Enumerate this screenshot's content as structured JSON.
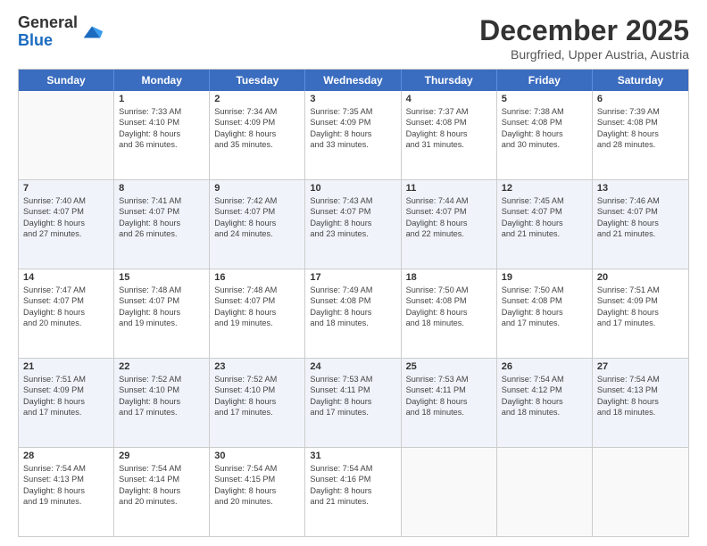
{
  "logo": {
    "general": "General",
    "blue": "Blue"
  },
  "header": {
    "month": "December 2025",
    "location": "Burgfried, Upper Austria, Austria"
  },
  "days": [
    "Sunday",
    "Monday",
    "Tuesday",
    "Wednesday",
    "Thursday",
    "Friday",
    "Saturday"
  ],
  "weeks": [
    {
      "alt": false,
      "cells": [
        {
          "day": "",
          "empty": true
        },
        {
          "day": "1",
          "sunrise": "Sunrise: 7:33 AM",
          "sunset": "Sunset: 4:10 PM",
          "daylight": "Daylight: 8 hours",
          "minutes": "and 36 minutes."
        },
        {
          "day": "2",
          "sunrise": "Sunrise: 7:34 AM",
          "sunset": "Sunset: 4:09 PM",
          "daylight": "Daylight: 8 hours",
          "minutes": "and 35 minutes."
        },
        {
          "day": "3",
          "sunrise": "Sunrise: 7:35 AM",
          "sunset": "Sunset: 4:09 PM",
          "daylight": "Daylight: 8 hours",
          "minutes": "and 33 minutes."
        },
        {
          "day": "4",
          "sunrise": "Sunrise: 7:37 AM",
          "sunset": "Sunset: 4:08 PM",
          "daylight": "Daylight: 8 hours",
          "minutes": "and 31 minutes."
        },
        {
          "day": "5",
          "sunrise": "Sunrise: 7:38 AM",
          "sunset": "Sunset: 4:08 PM",
          "daylight": "Daylight: 8 hours",
          "minutes": "and 30 minutes."
        },
        {
          "day": "6",
          "sunrise": "Sunrise: 7:39 AM",
          "sunset": "Sunset: 4:08 PM",
          "daylight": "Daylight: 8 hours",
          "minutes": "and 28 minutes."
        }
      ]
    },
    {
      "alt": true,
      "cells": [
        {
          "day": "7",
          "sunrise": "Sunrise: 7:40 AM",
          "sunset": "Sunset: 4:07 PM",
          "daylight": "Daylight: 8 hours",
          "minutes": "and 27 minutes."
        },
        {
          "day": "8",
          "sunrise": "Sunrise: 7:41 AM",
          "sunset": "Sunset: 4:07 PM",
          "daylight": "Daylight: 8 hours",
          "minutes": "and 26 minutes."
        },
        {
          "day": "9",
          "sunrise": "Sunrise: 7:42 AM",
          "sunset": "Sunset: 4:07 PM",
          "daylight": "Daylight: 8 hours",
          "minutes": "and 24 minutes."
        },
        {
          "day": "10",
          "sunrise": "Sunrise: 7:43 AM",
          "sunset": "Sunset: 4:07 PM",
          "daylight": "Daylight: 8 hours",
          "minutes": "and 23 minutes."
        },
        {
          "day": "11",
          "sunrise": "Sunrise: 7:44 AM",
          "sunset": "Sunset: 4:07 PM",
          "daylight": "Daylight: 8 hours",
          "minutes": "and 22 minutes."
        },
        {
          "day": "12",
          "sunrise": "Sunrise: 7:45 AM",
          "sunset": "Sunset: 4:07 PM",
          "daylight": "Daylight: 8 hours",
          "minutes": "and 21 minutes."
        },
        {
          "day": "13",
          "sunrise": "Sunrise: 7:46 AM",
          "sunset": "Sunset: 4:07 PM",
          "daylight": "Daylight: 8 hours",
          "minutes": "and 21 minutes."
        }
      ]
    },
    {
      "alt": false,
      "cells": [
        {
          "day": "14",
          "sunrise": "Sunrise: 7:47 AM",
          "sunset": "Sunset: 4:07 PM",
          "daylight": "Daylight: 8 hours",
          "minutes": "and 20 minutes."
        },
        {
          "day": "15",
          "sunrise": "Sunrise: 7:48 AM",
          "sunset": "Sunset: 4:07 PM",
          "daylight": "Daylight: 8 hours",
          "minutes": "and 19 minutes."
        },
        {
          "day": "16",
          "sunrise": "Sunrise: 7:48 AM",
          "sunset": "Sunset: 4:07 PM",
          "daylight": "Daylight: 8 hours",
          "minutes": "and 19 minutes."
        },
        {
          "day": "17",
          "sunrise": "Sunrise: 7:49 AM",
          "sunset": "Sunset: 4:08 PM",
          "daylight": "Daylight: 8 hours",
          "minutes": "and 18 minutes."
        },
        {
          "day": "18",
          "sunrise": "Sunrise: 7:50 AM",
          "sunset": "Sunset: 4:08 PM",
          "daylight": "Daylight: 8 hours",
          "minutes": "and 18 minutes."
        },
        {
          "day": "19",
          "sunrise": "Sunrise: 7:50 AM",
          "sunset": "Sunset: 4:08 PM",
          "daylight": "Daylight: 8 hours",
          "minutes": "and 17 minutes."
        },
        {
          "day": "20",
          "sunrise": "Sunrise: 7:51 AM",
          "sunset": "Sunset: 4:09 PM",
          "daylight": "Daylight: 8 hours",
          "minutes": "and 17 minutes."
        }
      ]
    },
    {
      "alt": true,
      "cells": [
        {
          "day": "21",
          "sunrise": "Sunrise: 7:51 AM",
          "sunset": "Sunset: 4:09 PM",
          "daylight": "Daylight: 8 hours",
          "minutes": "and 17 minutes."
        },
        {
          "day": "22",
          "sunrise": "Sunrise: 7:52 AM",
          "sunset": "Sunset: 4:10 PM",
          "daylight": "Daylight: 8 hours",
          "minutes": "and 17 minutes."
        },
        {
          "day": "23",
          "sunrise": "Sunrise: 7:52 AM",
          "sunset": "Sunset: 4:10 PM",
          "daylight": "Daylight: 8 hours",
          "minutes": "and 17 minutes."
        },
        {
          "day": "24",
          "sunrise": "Sunrise: 7:53 AM",
          "sunset": "Sunset: 4:11 PM",
          "daylight": "Daylight: 8 hours",
          "minutes": "and 17 minutes."
        },
        {
          "day": "25",
          "sunrise": "Sunrise: 7:53 AM",
          "sunset": "Sunset: 4:11 PM",
          "daylight": "Daylight: 8 hours",
          "minutes": "and 18 minutes."
        },
        {
          "day": "26",
          "sunrise": "Sunrise: 7:54 AM",
          "sunset": "Sunset: 4:12 PM",
          "daylight": "Daylight: 8 hours",
          "minutes": "and 18 minutes."
        },
        {
          "day": "27",
          "sunrise": "Sunrise: 7:54 AM",
          "sunset": "Sunset: 4:13 PM",
          "daylight": "Daylight: 8 hours",
          "minutes": "and 18 minutes."
        }
      ]
    },
    {
      "alt": false,
      "cells": [
        {
          "day": "28",
          "sunrise": "Sunrise: 7:54 AM",
          "sunset": "Sunset: 4:13 PM",
          "daylight": "Daylight: 8 hours",
          "minutes": "and 19 minutes."
        },
        {
          "day": "29",
          "sunrise": "Sunrise: 7:54 AM",
          "sunset": "Sunset: 4:14 PM",
          "daylight": "Daylight: 8 hours",
          "minutes": "and 20 minutes."
        },
        {
          "day": "30",
          "sunrise": "Sunrise: 7:54 AM",
          "sunset": "Sunset: 4:15 PM",
          "daylight": "Daylight: 8 hours",
          "minutes": "and 20 minutes."
        },
        {
          "day": "31",
          "sunrise": "Sunrise: 7:54 AM",
          "sunset": "Sunset: 4:16 PM",
          "daylight": "Daylight: 8 hours",
          "minutes": "and 21 minutes."
        },
        {
          "day": "",
          "empty": true
        },
        {
          "day": "",
          "empty": true
        },
        {
          "day": "",
          "empty": true
        }
      ]
    }
  ]
}
